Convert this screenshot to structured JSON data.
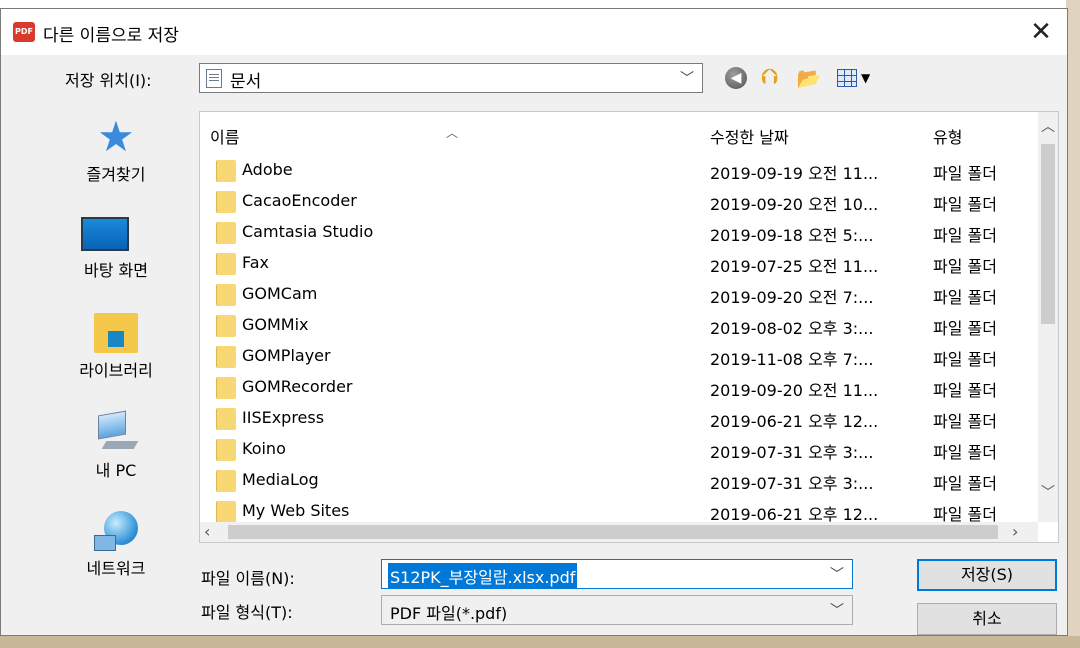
{
  "window": {
    "title": "다른 이름으로 저장",
    "app_icon_text": "PDF",
    "close_glyph": "✕"
  },
  "toolbar": {
    "save_in_label": "저장 위치(I):",
    "save_in_value": "문서",
    "icons": [
      "back-icon",
      "up-folder-icon",
      "new-folder-icon",
      "view-menu-icon"
    ]
  },
  "places": [
    {
      "label": "즐겨찾기",
      "icon": "star-icon"
    },
    {
      "label": "바탕 화면",
      "icon": "desktop-icon"
    },
    {
      "label": "라이브러리",
      "icon": "library-icon"
    },
    {
      "label": "내 PC",
      "icon": "computer-icon"
    },
    {
      "label": "네트워크",
      "icon": "network-icon"
    }
  ],
  "file_list": {
    "columns": [
      "이름",
      "수정한 날짜",
      "유형"
    ],
    "rows": [
      {
        "name": "Adobe",
        "date": "2019-09-19 오전 11...",
        "type": "파일 폴더"
      },
      {
        "name": "CacaoEncoder",
        "date": "2019-09-20 오전 10...",
        "type": "파일 폴더"
      },
      {
        "name": "Camtasia Studio",
        "date": "2019-09-18 오전 5:...",
        "type": "파일 폴더"
      },
      {
        "name": "Fax",
        "date": "2019-07-25 오전 11...",
        "type": "파일 폴더"
      },
      {
        "name": "GOMCam",
        "date": "2019-09-20 오전 7:...",
        "type": "파일 폴더"
      },
      {
        "name": "GOMMix",
        "date": "2019-08-02 오후 3:...",
        "type": "파일 폴더"
      },
      {
        "name": "GOMPlayer",
        "date": "2019-11-08 오후 7:...",
        "type": "파일 폴더"
      },
      {
        "name": "GOMRecorder",
        "date": "2019-09-20 오전 11...",
        "type": "파일 폴더"
      },
      {
        "name": "IISExpress",
        "date": "2019-06-21 오후 12...",
        "type": "파일 폴더"
      },
      {
        "name": "Koino",
        "date": "2019-07-31 오후 3:...",
        "type": "파일 폴더"
      },
      {
        "name": "MediaLog",
        "date": "2019-07-31 오후 3:...",
        "type": "파일 폴더"
      },
      {
        "name": "My Web Sites",
        "date": "2019-06-21 오후 12...",
        "type": "파일 폴더"
      }
    ]
  },
  "form": {
    "filename_label": "파일 이름(N):",
    "filename_value": "S12PK_부장일람.xlsx.pdf",
    "filetype_label": "파일 형식(T):",
    "filetype_value": "PDF 파일(*.pdf)"
  },
  "buttons": {
    "save": "저장(S)",
    "cancel": "취소"
  },
  "colors": {
    "accent": "#0078d7",
    "folder": "#f8d775",
    "pdf_icon": "#d93a2b"
  }
}
